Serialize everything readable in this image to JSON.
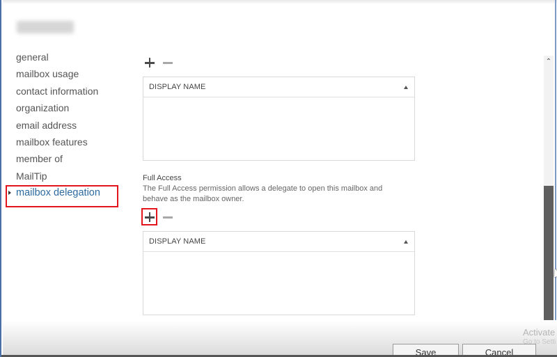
{
  "window": {
    "title": ""
  },
  "sidebar": {
    "items": [
      {
        "label": "general",
        "active": false
      },
      {
        "label": "mailbox usage",
        "active": false
      },
      {
        "label": "contact information",
        "active": false
      },
      {
        "label": "organization",
        "active": false
      },
      {
        "label": "email address",
        "active": false
      },
      {
        "label": "mailbox features",
        "active": false
      },
      {
        "label": "member of",
        "active": false
      },
      {
        "label": "MailTip",
        "active": false
      },
      {
        "label": "mailbox delegation",
        "active": true
      }
    ]
  },
  "main": {
    "send_as": {
      "add_icon": "plus-icon",
      "remove_icon": "minus-icon",
      "grid": {
        "columns": [
          {
            "header": "DISPLAY NAME",
            "sort": "ascending"
          }
        ],
        "rows": []
      }
    },
    "full_access": {
      "title": "Full Access",
      "description": "The Full Access permission allows a delegate to open this mailbox and behave as the mailbox owner.",
      "add_icon": "plus-icon",
      "remove_icon": "minus-icon",
      "grid": {
        "columns": [
          {
            "header": "DISPLAY NAME",
            "sort": "ascending"
          }
        ],
        "rows": []
      }
    }
  },
  "footer": {
    "save_label": "Save",
    "cancel_label": "Cancel"
  },
  "watermark": {
    "line1": "Activate",
    "line2": "Go to Setti"
  },
  "colors": {
    "accent_link": "#2c6aa0",
    "highlight_red": "#e3141b",
    "scroll_thumb": "#5f5f5f"
  }
}
